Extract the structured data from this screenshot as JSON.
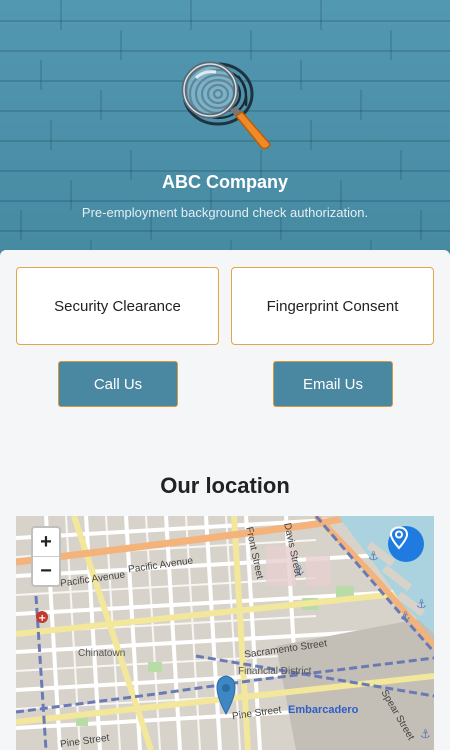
{
  "header": {
    "company_name": "ABC Company",
    "tagline": "Pre-employment background check authorization."
  },
  "cards": [
    {
      "label": "Security Clearance"
    },
    {
      "label": "Fingerprint Consent"
    }
  ],
  "actions": {
    "call_label": "Call Us",
    "email_label": "Email Us"
  },
  "location": {
    "title": "Our location",
    "map": {
      "zoom_in": "+",
      "zoom_out": "−",
      "streets": {
        "pacific_avenue_1": "Pacific Avenue",
        "pacific_avenue_2": "Pacific Avenue",
        "front_street": "Front Street",
        "davis_street": "Davis Street",
        "chinatown": "Chinatown",
        "sacramento_street": "Sacramento Street",
        "financial_district": "Financial District",
        "pine_street_1": "Pine Street",
        "pine_street_2": "Pine Street",
        "embarcadero": "Embarcadero",
        "spear_street": "Spear Street"
      }
    }
  },
  "colors": {
    "header_bg": "#4a8fa7",
    "button_bg": "#4a87a0",
    "accent_border": "#e3a54c",
    "map_marker": "#3e86c4"
  }
}
